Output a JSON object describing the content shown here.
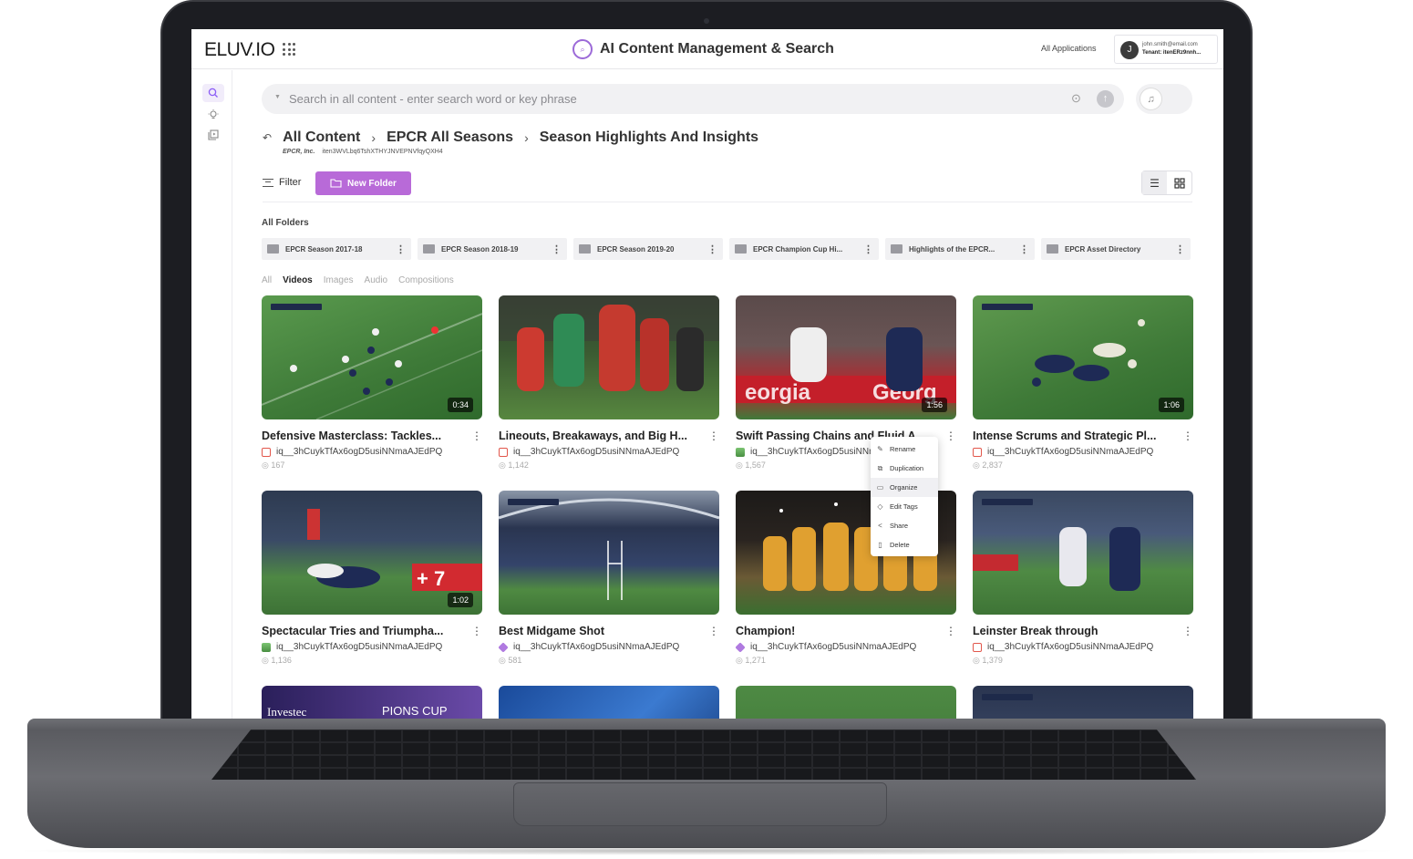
{
  "header": {
    "logo": "ELUV.IO",
    "app_title": "AI Content Management & Search",
    "all_applications": "All Applications",
    "user_initial": "J",
    "user_email": "john.smith@email.com",
    "user_tenant": "Tenant: itenERz9nnh..."
  },
  "search": {
    "placeholder": "Search in all content - enter search word or key phrase"
  },
  "breadcrumb": {
    "items": [
      "All Content",
      "EPCR All Seasons",
      "Season Highlights And Insights"
    ],
    "org": "EPCR, Inc.",
    "tenant_id": "iten3WVLbq6TshXTHYJNVEPNVfqyQXH4"
  },
  "toolbar": {
    "filter_label": "Filter",
    "new_folder_label": "New Folder"
  },
  "folders": {
    "heading": "All Folders",
    "items": [
      "EPCR Season 2017-18",
      "EPCR Season 2018-19",
      "EPCR Season 2019-20",
      "EPCR Champion Cup Hi...",
      "Highlights of the EPCR...",
      "EPCR Asset Directory"
    ]
  },
  "tabs": [
    "All",
    "Videos",
    "Images",
    "Audio",
    "Compositions"
  ],
  "active_tab": "Videos",
  "cards": [
    {
      "title": "Defensive Masterclass: Tackles...",
      "id": "iq__3hCuykTfAx6ogD5usiNNmaAJEdPQ",
      "views": "167",
      "duration": "0:34",
      "type": "video"
    },
    {
      "title": "Lineouts, Breakaways, and Big H...",
      "id": "iq__3hCuykTfAx6ogD5usiNNmaAJEdPQ",
      "views": "1,142",
      "duration": "",
      "type": "video"
    },
    {
      "title": "Swift Passing Chains and Fluid A...",
      "id": "iq__3hCuykTfAx6ogD5usiNNmaAJEdPQ",
      "views": "1,567",
      "duration": "1:56",
      "type": "image"
    },
    {
      "title": "Intense Scrums and Strategic Pl...",
      "id": "iq__3hCuykTfAx6ogD5usiNNmaAJEdPQ",
      "views": "2,837",
      "duration": "1:06",
      "type": "video"
    },
    {
      "title": "Spectacular Tries and Triumpha...",
      "id": "iq__3hCuykTfAx6ogD5usiNNmaAJEdPQ",
      "views": "1,136",
      "duration": "1:02",
      "type": "image"
    },
    {
      "title": "Best Midgame Shot",
      "id": "iq__3hCuykTfAx6ogD5usiNNmaAJEdPQ",
      "views": "581",
      "duration": "",
      "type": "comp"
    },
    {
      "title": "Champion!",
      "id": "iq__3hCuykTfAx6ogD5usiNNmaAJEdPQ",
      "views": "1,271",
      "duration": "",
      "type": "comp"
    },
    {
      "title": "Leinster Break through",
      "id": "iq__3hCuykTfAx6ogD5usiNNmaAJEdPQ",
      "views": "1,379",
      "duration": "",
      "type": "video"
    }
  ],
  "context_menu": [
    "Rename",
    "Duplication",
    "Organize",
    "Edit Tags",
    "Share",
    "Delete"
  ],
  "partial_row": {
    "card_1_text": "Investec",
    "card_1_text_b": "PIONS CUP"
  },
  "colors": {
    "accent": "#b86ad8",
    "pitch": "#3f7a3a"
  }
}
